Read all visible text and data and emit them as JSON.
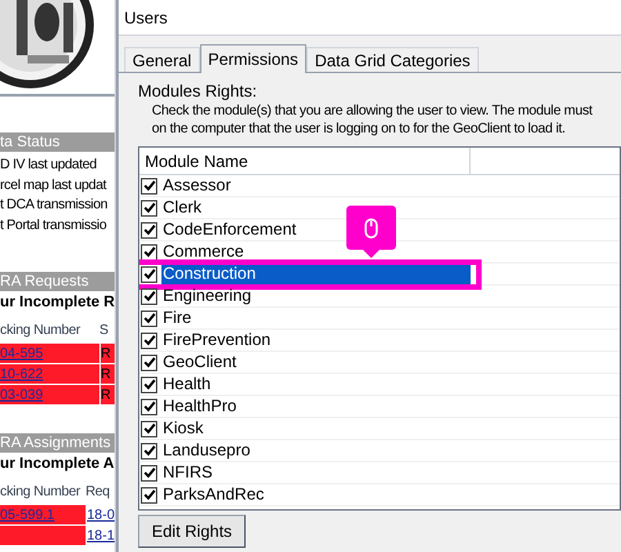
{
  "left_panel": {
    "status_title": "ta Status",
    "status_lines": [
      "D IV last updated",
      "rcel map last updat",
      "t DCA transmission",
      "t Portal transmissio"
    ],
    "requests": {
      "title": "RA Requests",
      "subtitle": "ur Incomplete R",
      "columns": [
        "cking Number",
        "S"
      ],
      "rows": [
        [
          "04-595",
          "R"
        ],
        [
          "10-622",
          "R"
        ],
        [
          "03-039",
          "R"
        ]
      ]
    },
    "assignments": {
      "title": "RA Assignments",
      "subtitle": "ur Incomplete A",
      "columns": [
        "cking Number",
        "Req"
      ],
      "rows": [
        [
          "05-599.1",
          "18-0"
        ],
        [
          "",
          "18-1"
        ]
      ]
    }
  },
  "window": {
    "title": "Users"
  },
  "tabs": [
    {
      "label": "General",
      "selected": false
    },
    {
      "label": "Permissions",
      "selected": true
    },
    {
      "label": "Data Grid Categories",
      "selected": false
    }
  ],
  "section_title": "Modules Rights:",
  "instructions": [
    "Check the module(s) that you are allowing the user to view.  The module must",
    "on the computer that the user is logging on to for the GeoClient to load it."
  ],
  "table": {
    "columns": [
      "Module Name"
    ],
    "rows": [
      {
        "name": "Assessor",
        "checked": true,
        "selected": false
      },
      {
        "name": "Clerk",
        "checked": true,
        "selected": false
      },
      {
        "name": "CodeEnforcement",
        "checked": true,
        "selected": false
      },
      {
        "name": "Commerce",
        "checked": true,
        "selected": false
      },
      {
        "name": "Construction",
        "checked": true,
        "selected": true
      },
      {
        "name": "Engineering",
        "checked": true,
        "selected": false
      },
      {
        "name": "Fire",
        "checked": true,
        "selected": false
      },
      {
        "name": "FirePrevention",
        "checked": true,
        "selected": false
      },
      {
        "name": "GeoClient",
        "checked": true,
        "selected": false
      },
      {
        "name": "Health",
        "checked": true,
        "selected": false
      },
      {
        "name": "HealthPro",
        "checked": true,
        "selected": false
      },
      {
        "name": "Kiosk",
        "checked": true,
        "selected": false
      },
      {
        "name": "Landusepro",
        "checked": true,
        "selected": false
      },
      {
        "name": "NFIRS",
        "checked": true,
        "selected": false
      },
      {
        "name": "ParksAndRec",
        "checked": true,
        "selected": false
      }
    ]
  },
  "buttons": [
    "Edit Rights"
  ]
}
